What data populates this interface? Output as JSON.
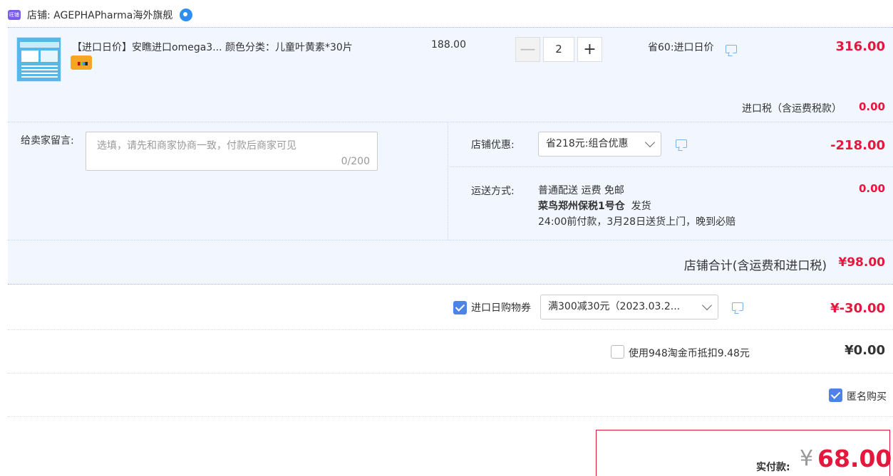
{
  "shop": {
    "icon_text": "旺铺",
    "name": "店铺: AGEPHAPharma海外旗舰"
  },
  "item": {
    "title": "【进口日价】安瞧进口omega3... 颜色分类：儿童叶黄素*30片",
    "unit_price": "188.00",
    "quantity": "2",
    "minus_label": "—",
    "plus_label": "+",
    "save_text": "省60:进口日价",
    "total": "316.00"
  },
  "tax": {
    "label": "进口税（含运费税款）",
    "value": "0.00"
  },
  "message": {
    "label": "给卖家留言:",
    "placeholder": "选填，请先和商家协商一致，付款后商家可见",
    "count": "0/200"
  },
  "promo": {
    "label": "店铺优惠:",
    "selected": "省218元:组合优惠",
    "value": "-218.00"
  },
  "shipping": {
    "label": "运送方式:",
    "line1": "普通配送 运费 免邮",
    "warehouse": "菜鸟郑州保税1号仓",
    "ship_note": "发货",
    "line3": "24:00前付款，3月28日送货上门，晚到必赔",
    "value": "0.00"
  },
  "subtotal": {
    "label": "店铺合计(含运费和进口税)",
    "value": "¥98.00"
  },
  "coupon": {
    "checked": true,
    "label": "进口日购物券",
    "selected": "满300减30元（2023.03.2...",
    "value": "¥-30.00"
  },
  "coins": {
    "checked": false,
    "label": "使用948淘金币抵扣9.48元",
    "value": "¥0.00"
  },
  "anonymous": {
    "checked": true,
    "label": "匿名购买"
  },
  "payment": {
    "label": "实付款:",
    "currency": "¥",
    "value": "68.00"
  },
  "colors": {
    "accent_red": "#e4173d",
    "accent_blue": "#4d83e8",
    "block_bg": "#f2f7ff"
  }
}
